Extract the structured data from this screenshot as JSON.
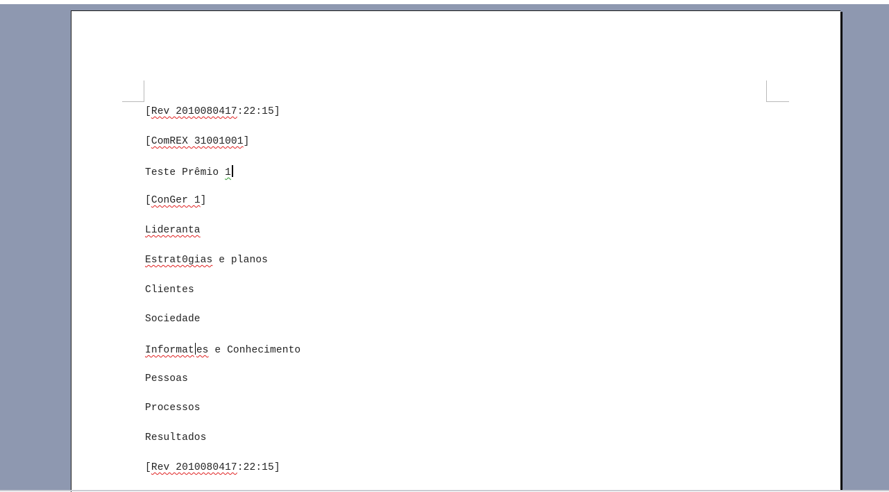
{
  "document": {
    "lines": [
      {
        "parts": [
          "[",
          "Rev 2010080417",
          ":22:15]"
        ]
      },
      {
        "parts": [
          "[",
          "ComREX 31001001",
          "]"
        ]
      },
      {
        "parts": [
          "Teste Prêmio ",
          "1",
          ""
        ]
      },
      {
        "parts": [
          "[",
          "ConGer 1",
          "]"
        ]
      },
      {
        "parts": [
          "",
          "Lideranta",
          ""
        ]
      },
      {
        "parts": [
          "",
          "Estrat0gias",
          " e planos"
        ]
      },
      {
        "parts": [
          "Clientes",
          "",
          ""
        ]
      },
      {
        "parts": [
          "Sociedade",
          "",
          ""
        ]
      },
      {
        "parts": [
          "",
          "Informat",
          "es",
          " e Conhecimento"
        ]
      },
      {
        "parts": [
          "Pessoas",
          "",
          ""
        ]
      },
      {
        "parts": [
          "Processos",
          "",
          ""
        ]
      },
      {
        "parts": [
          "Resultados",
          "",
          ""
        ]
      },
      {
        "parts": [
          "[",
          "Rev 2010080417",
          ":22:15]"
        ]
      }
    ]
  },
  "colors": {
    "workspace": "#8e98b0",
    "page": "#ffffff",
    "spelling_underline": "#e02020",
    "grammar_underline": "#2e9a2e"
  }
}
